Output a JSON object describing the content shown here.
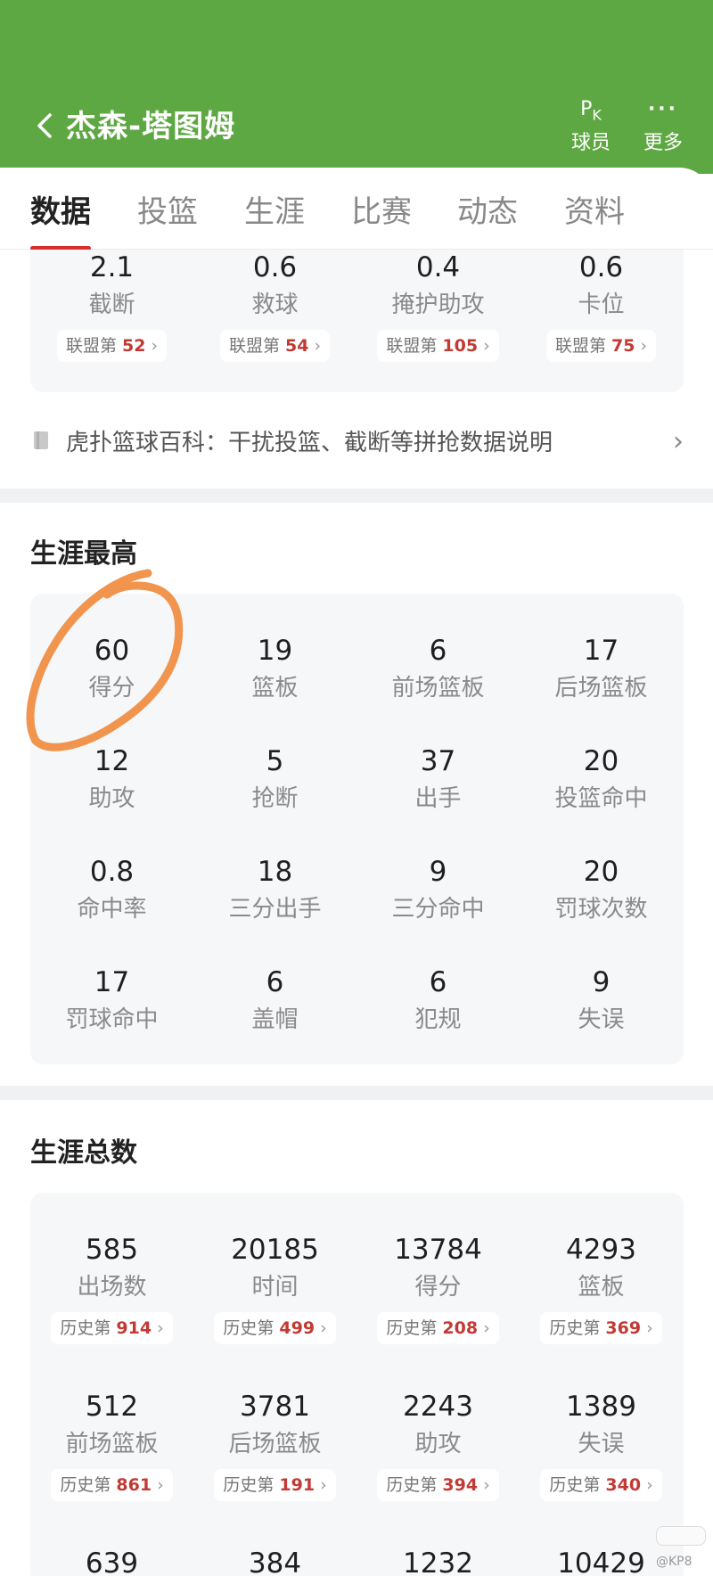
{
  "header": {
    "title": "杰森-塔图姆",
    "pk_icon_text": "PK",
    "pk_label": "球员",
    "more_label": "更多"
  },
  "tabs": [
    {
      "label": "数据",
      "active": true
    },
    {
      "label": "投篮"
    },
    {
      "label": "生涯"
    },
    {
      "label": "比赛"
    },
    {
      "label": "动态"
    },
    {
      "label": "资料"
    }
  ],
  "defense_stats": [
    {
      "value": "2.1",
      "label": "截断",
      "rank_prefix": "联盟第",
      "rank": "52"
    },
    {
      "value": "0.6",
      "label": "救球",
      "rank_prefix": "联盟第",
      "rank": "54"
    },
    {
      "value": "0.4",
      "label": "掩护助攻",
      "rank_prefix": "联盟第",
      "rank": "105"
    },
    {
      "value": "0.6",
      "label": "卡位",
      "rank_prefix": "联盟第",
      "rank": "75"
    }
  ],
  "wiki": {
    "text": "虎扑篮球百科：干扰投篮、截断等拼抢数据说明"
  },
  "career_high": {
    "title": "生涯最高",
    "items": [
      {
        "value": "60",
        "label": "得分"
      },
      {
        "value": "19",
        "label": "篮板"
      },
      {
        "value": "6",
        "label": "前场篮板"
      },
      {
        "value": "17",
        "label": "后场篮板"
      },
      {
        "value": "12",
        "label": "助攻"
      },
      {
        "value": "5",
        "label": "抢断"
      },
      {
        "value": "37",
        "label": "出手"
      },
      {
        "value": "20",
        "label": "投篮命中"
      },
      {
        "value": "0.8",
        "label": "命中率"
      },
      {
        "value": "18",
        "label": "三分出手"
      },
      {
        "value": "9",
        "label": "三分命中"
      },
      {
        "value": "20",
        "label": "罚球次数"
      },
      {
        "value": "17",
        "label": "罚球命中"
      },
      {
        "value": "6",
        "label": "盖帽"
      },
      {
        "value": "6",
        "label": "犯规"
      },
      {
        "value": "9",
        "label": "失误"
      }
    ]
  },
  "career_total": {
    "title": "生涯总数",
    "rank_prefix": "历史第",
    "items": [
      {
        "value": "585",
        "label": "出场数",
        "rank": "914"
      },
      {
        "value": "20185",
        "label": "时间",
        "rank": "499"
      },
      {
        "value": "13784",
        "label": "得分",
        "rank": "208"
      },
      {
        "value": "4293",
        "label": "篮板",
        "rank": "369"
      },
      {
        "value": "512",
        "label": "前场篮板",
        "rank": "861"
      },
      {
        "value": "3781",
        "label": "后场篮板",
        "rank": "191"
      },
      {
        "value": "2243",
        "label": "助攻",
        "rank": "394"
      },
      {
        "value": "1389",
        "label": "失误",
        "rank": "340"
      },
      {
        "value": "639"
      },
      {
        "value": "384"
      },
      {
        "value": "1232"
      },
      {
        "value": "10429"
      }
    ]
  },
  "watermark": "@KP8",
  "colors": {
    "header_green": "#5ea843",
    "accent_red": "#d4302d",
    "rank_red": "#c23a34",
    "annotation_orange": "#f0944e"
  }
}
